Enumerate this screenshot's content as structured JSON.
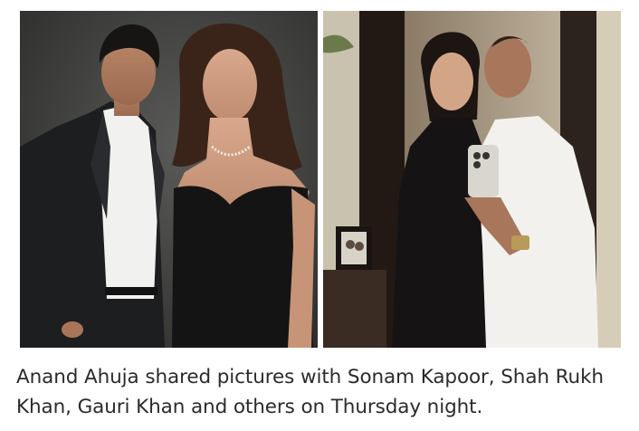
{
  "article_photo": {
    "left_image_alt": "Shah Rukh Khan and Gauri Khan posing together",
    "right_image_alt": "Sonam Kapoor and Anand Ahuja mirror selfie"
  },
  "caption": {
    "text": "Anand Ahuja shared pictures with Sonam Kapoor, Shah Rukh Khan, Gauri Khan and others on Thursday night."
  }
}
